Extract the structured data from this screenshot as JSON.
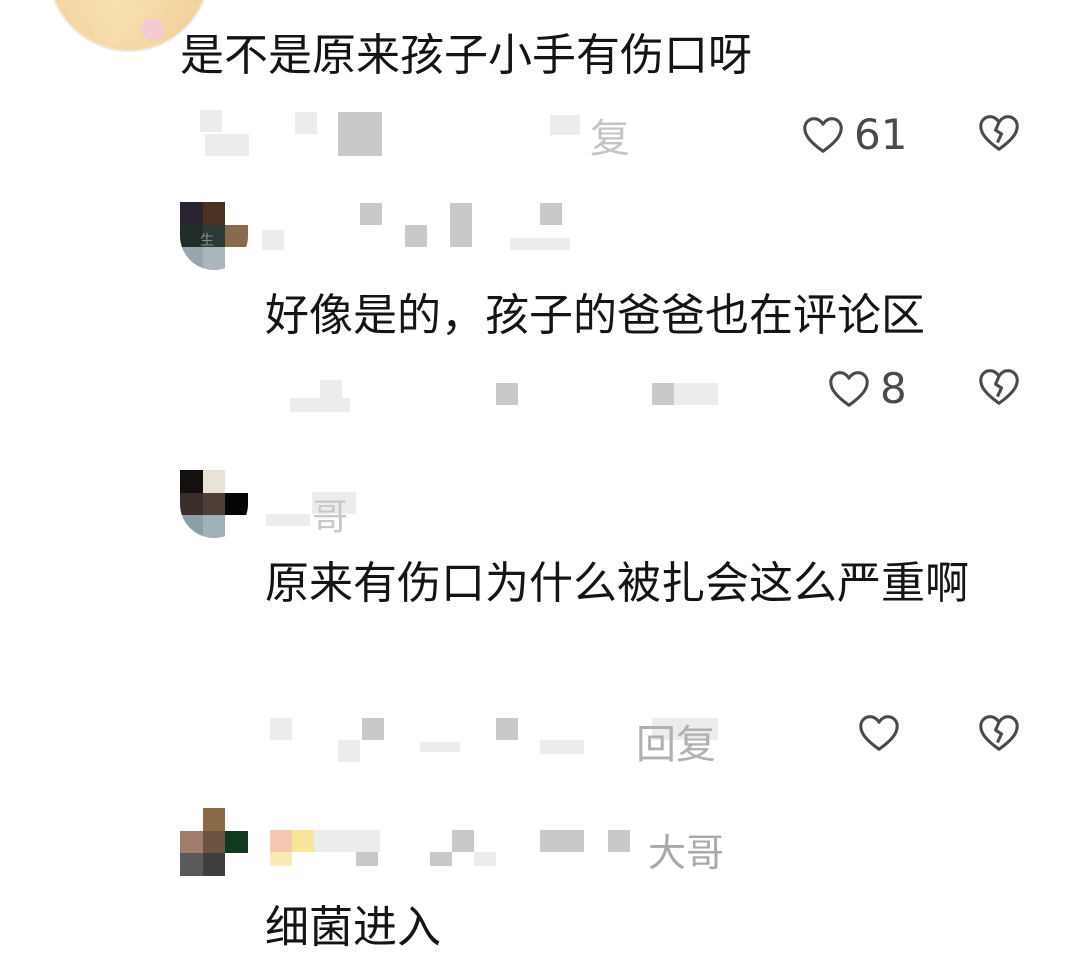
{
  "comments": [
    {
      "text": "是不是原来孩子小手有伤口呀",
      "likes": "61",
      "meta_fragment": "复"
    },
    {
      "text": "好像是的，孩子的爸爸也在评论区",
      "likes": "8",
      "username_fragment": "生"
    },
    {
      "text": "原来有伤口为什么被扎会这么严重啊",
      "likes": "",
      "username_fragment": "哥",
      "meta_fragment": "回复"
    },
    {
      "text": "细菌进入",
      "username_fragment": "大哥"
    }
  ],
  "icons": {
    "like": "heart-outline-icon",
    "dislike": "broken-heart-icon"
  },
  "colors": {
    "text": "#141414",
    "muted": "#4a4a4a",
    "pixelated": "#d9d9d9"
  }
}
